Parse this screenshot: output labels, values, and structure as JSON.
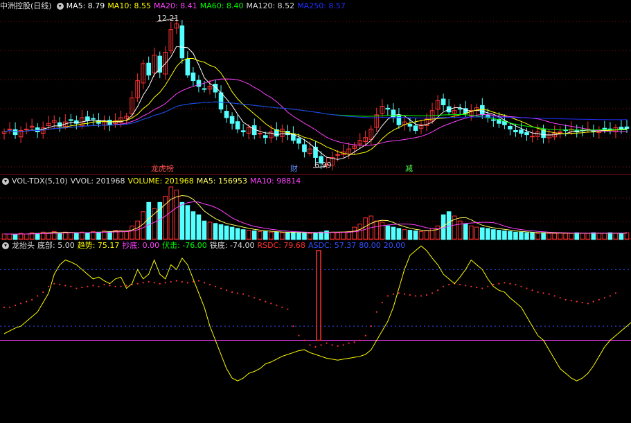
{
  "price_panel": {
    "stock_name": "中洲控股",
    "period": "(日线)",
    "ma_labels": [
      {
        "text": "MA5: 8.79",
        "color": "#ffffff"
      },
      {
        "text": "MA10: 8.55",
        "color": "#ffff00"
      },
      {
        "text": "MA20: 8.41",
        "color": "#ff40ff"
      },
      {
        "text": "MA60: 8.40",
        "color": "#00ff00"
      },
      {
        "text": "MA120: 8.52",
        "color": "#dddddd"
      },
      {
        "text": "MA250: 8.57",
        "color": "#2030ff"
      }
    ],
    "high_mark": "12.21",
    "low_mark": "6.99",
    "event_tags": [
      {
        "text": "龙虎榜",
        "color": "#ff5050"
      },
      {
        "text": "财",
        "color": "#6090ff"
      },
      {
        "text": "减",
        "color": "#50ff50"
      }
    ]
  },
  "volume_panel": {
    "labels": [
      {
        "text": "VOL-TDX(5,10)",
        "color": "#dddddd"
      },
      {
        "text": "VVOL: 201968",
        "color": "#dddddd"
      },
      {
        "text": "VOLUME: 201968",
        "color": "#ffff00"
      },
      {
        "text": "MA5: 156953",
        "color": "#ffff60"
      },
      {
        "text": "MA10: 98814",
        "color": "#ff40ff"
      }
    ]
  },
  "indicator_panel": {
    "labels": [
      {
        "text": "龙抬头",
        "color": "#dddddd"
      },
      {
        "text": "底部: 5.00",
        "color": "#dddddd"
      },
      {
        "text": "趋势: 75.17",
        "color": "#ffff00"
      },
      {
        "text": "抄底: 0.00",
        "color": "#ff40ff"
      },
      {
        "text": "伏击: -76.00",
        "color": "#00ff00"
      },
      {
        "text": "铁底: -74.00",
        "color": "#dddddd"
      },
      {
        "text": "RSDC: 79.68",
        "color": "#ff3030"
      },
      {
        "text": "ASDC: 57.37",
        "color": "#3050ff"
      },
      {
        "text": "80.00",
        "color": "#3050ff"
      },
      {
        "text": "20.00",
        "color": "#3050ff"
      }
    ]
  },
  "colors": {
    "up": "#ff3232",
    "down": "#54ffff",
    "grid": "#8a1010",
    "ma5": "#ffffff",
    "ma10": "#ffff00",
    "ma20": "#ff40ff",
    "ma60": "#00ff00",
    "ma250": "#2030ff"
  },
  "chart_data": [
    {
      "type": "candlestick",
      "title": "中洲控股(日线)",
      "close": [
        8.2,
        8.3,
        8.1,
        8.25,
        8.3,
        8.4,
        8.2,
        8.35,
        8.5,
        8.6,
        8.4,
        8.55,
        8.6,
        8.5,
        8.7,
        8.6,
        8.65,
        8.5,
        8.55,
        8.45,
        8.6,
        8.7,
        8.75,
        9.4,
        10.0,
        10.6,
        10.2,
        10.9,
        10.3,
        11.0,
        11.8,
        12.0,
        10.8,
        10.2,
        10.0,
        9.8,
        9.7,
        9.8,
        9.6,
        9.0,
        8.7,
        8.5,
        8.3,
        8.2,
        8.35,
        8.1,
        8.15,
        8.0,
        8.2,
        8.05,
        8.3,
        8.1,
        7.9,
        7.8,
        7.5,
        7.6,
        7.3,
        7.1,
        7.05,
        7.3,
        7.4,
        7.5,
        7.6,
        7.7,
        7.9,
        8.0,
        8.3,
        8.8,
        9.1,
        9.0,
        8.7,
        8.45,
        8.55,
        8.4,
        8.25,
        8.45,
        8.65,
        8.95,
        9.3,
        9.15,
        8.9,
        8.95,
        9.0,
        8.85,
        8.95,
        9.05,
        8.8,
        8.7,
        8.6,
        8.5,
        8.45,
        8.3,
        8.2,
        8.15,
        8.1,
        8.05,
        8.2,
        8.0,
        8.1,
        8.15,
        8.2,
        8.25,
        8.3,
        8.2,
        8.25,
        8.3,
        8.2,
        8.25,
        8.3,
        8.28,
        8.35,
        8.3,
        8.32
      ],
      "high_label": 12.21,
      "low_label": 6.99,
      "ma_current": {
        "MA5": 8.79,
        "MA10": 8.55,
        "MA20": 8.41,
        "MA60": 8.4,
        "MA120": 8.52,
        "MA250": 8.57
      }
    },
    {
      "type": "bar",
      "title": "VOL-TDX(5,10)",
      "values": [
        9,
        9,
        8,
        10,
        9,
        11,
        10,
        12,
        11,
        13,
        10,
        12,
        11,
        10,
        12,
        11,
        13,
        12,
        14,
        13,
        15,
        14,
        13,
        22,
        30,
        45,
        60,
        50,
        60,
        70,
        85,
        80,
        60,
        55,
        45,
        40,
        30,
        28,
        26,
        24,
        22,
        20,
        18,
        16,
        15,
        14,
        13,
        13,
        12,
        12,
        11,
        11,
        12,
        11,
        11,
        10,
        11,
        12,
        14,
        12,
        11,
        12,
        13,
        20,
        25,
        35,
        38,
        30,
        28,
        22,
        20,
        18,
        16,
        15,
        14,
        13,
        14,
        18,
        22,
        40,
        45,
        38,
        30,
        25,
        22,
        20,
        19,
        18,
        16,
        15,
        14,
        13,
        12,
        12,
        11,
        11,
        10,
        11,
        10,
        10,
        11,
        10,
        10,
        11,
        10,
        10,
        11,
        10,
        10,
        11,
        10,
        10,
        11
      ],
      "current": {
        "VVOL": 201968,
        "VOLUME": 201968,
        "MA5": 156953,
        "MA10": 98814
      }
    },
    {
      "type": "line",
      "title": "龙抬头",
      "series": [
        {
          "name": "趋势",
          "values": [
            12,
            15,
            18,
            20,
            25,
            30,
            35,
            45,
            55,
            75,
            85,
            90,
            88,
            85,
            80,
            75,
            70,
            72,
            68,
            65,
            70,
            72,
            60,
            65,
            80,
            70,
            75,
            90,
            75,
            70,
            85,
            80,
            92,
            85,
            70,
            55,
            40,
            20,
            5,
            -10,
            -25,
            -35,
            -38,
            -35,
            -30,
            -28,
            -25,
            -20,
            -18,
            -15,
            -12,
            -10,
            -8,
            -6,
            -5,
            -8,
            -10,
            -12,
            -14,
            -15,
            -16,
            -15,
            -14,
            -13,
            -12,
            -10,
            -5,
            5,
            15,
            25,
            40,
            60,
            80,
            95,
            100,
            105,
            100,
            92,
            85,
            75,
            70,
            65,
            72,
            80,
            90,
            85,
            80,
            70,
            62,
            58,
            56,
            50,
            45,
            40,
            30,
            20,
            10,
            5,
            -5,
            -15,
            -25,
            -30,
            -35,
            -38,
            -35,
            -30,
            -22,
            -12,
            -2,
            5,
            10,
            15,
            20,
            25,
            35
          ]
        },
        {
          "name": "RSDC",
          "values": [
            40,
            40,
            42,
            44,
            46,
            48,
            52,
            56,
            62,
            65,
            64,
            63,
            62,
            60,
            61,
            62,
            63,
            62,
            64,
            63,
            62,
            62,
            63,
            64,
            65,
            66,
            67,
            66,
            65,
            66,
            67,
            68,
            67,
            66,
            67,
            68,
            66,
            64,
            62,
            60,
            58,
            56,
            55,
            54,
            52,
            50,
            48,
            46,
            44,
            42,
            40,
            38,
            20,
            10,
            5,
            0,
            -2,
            0,
            2,
            0,
            -1,
            0,
            2,
            3,
            5,
            10,
            20,
            35,
            45,
            52,
            54,
            55,
            54,
            53,
            52,
            52,
            53,
            55,
            58,
            62,
            64,
            65,
            64,
            63,
            62,
            61,
            60,
            62,
            64,
            65,
            66,
            65,
            64,
            62,
            60,
            58,
            56,
            55,
            54,
            52,
            50,
            48,
            47,
            46,
            45,
            44,
            46,
            48,
            50,
            52,
            55
          ]
        }
      ],
      "ylim": [
        -76,
        100
      ],
      "reference_lines": [
        80,
        20
      ],
      "current": {
        "底部": 5.0,
        "趋势": 75.17,
        "抄底": 0.0,
        "伏击": -76.0,
        "铁底": -74.0,
        "RSDC": 79.68,
        "ASDC": 57.37
      }
    }
  ]
}
